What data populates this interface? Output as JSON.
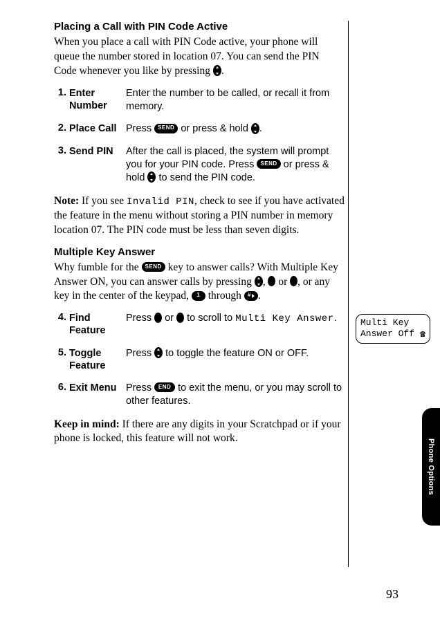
{
  "section1": {
    "heading": "Placing a Call with PIN Code Active",
    "intro_pre": "When you place a call with PIN Code active, your phone will queue the number stored in location 07. You can send the PIN Code whenever you like by pressing ",
    "intro_post": ".",
    "steps": [
      {
        "num": "1.",
        "title": "Enter Number",
        "desc_pre": "Enter the number to be called, or recall it from memory.",
        "desc_post": ""
      },
      {
        "num": "2.",
        "title": "Place Call",
        "desc_pre": "Press ",
        "send": "SEND",
        "mid": " or press & hold ",
        "desc_post": "."
      },
      {
        "num": "3.",
        "title": "Send PIN",
        "desc_pre": "After the call is placed, the system will prompt you for your PIN code. Press ",
        "send": "SEND",
        "mid": " or press & hold ",
        "desc_post": " to send the PIN code."
      }
    ],
    "note_label": "Note:",
    "note_pre": " If you see ",
    "note_code": "Invalid PIN",
    "note_post": ", check to see if you have acti­vated the feature in the menu without storing a PIN number in memory location 07. The PIN code must be less than seven digits."
  },
  "section2": {
    "heading": "Multiple Key Answer",
    "intro1": "Why fumble for the ",
    "send": "SEND",
    "intro2": " key to answer calls? With Multiple Key Answer ON, you can answer calls by pressing ",
    "comma": ", ",
    "or": " or ",
    "intro3": ", or any key in the center of the keypad, ",
    "key1": "1",
    "through": " through ",
    "keyhash": "#",
    "intro4": ".",
    "steps": [
      {
        "num": "4.",
        "title": "Find Feature",
        "pre": "Press ",
        "or": " or ",
        "mid": " to scroll to ",
        "code": "Multi Key Answer",
        "post": "."
      },
      {
        "num": "5.",
        "title": "Toggle Feature",
        "pre": "Press ",
        "post": " to toggle the feature ON or OFF."
      },
      {
        "num": "6.",
        "title": "Exit Menu",
        "pre": "Press ",
        "end": "END",
        "post": " to exit the menu, or you may scroll to other features."
      }
    ],
    "keep_label": "Keep in mind:",
    "keep_text": " If there are any digits in your Scratchpad or if your phone is locked, this feature will not work."
  },
  "screen": {
    "line1": "Multi Key",
    "line2": "Answer Off"
  },
  "side_tab": "Phone Options",
  "page_number": "93"
}
